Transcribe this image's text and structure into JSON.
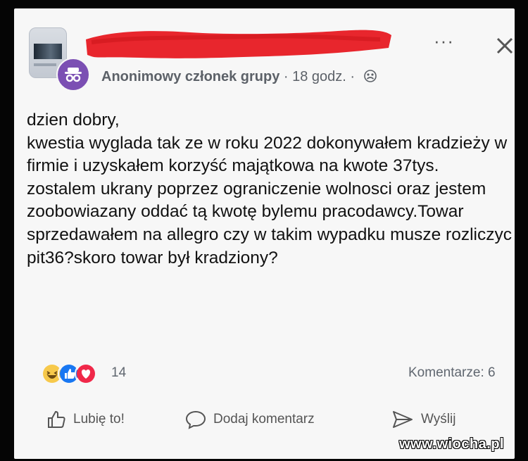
{
  "post": {
    "author": "Anonimowy członek grupy",
    "meta": " · 18 godz. · ",
    "privacy_icon": "group-members-icon",
    "body_lines": [
      "dzien dobry,",
      "kwestia wyglada tak ze w roku 2022 dokonywałem kradzieży w firmie i uzyskałem korzyść majątkowa na kwote 37tys.",
      "zostalem ukrany poprzez ograniczenie wolnosci oraz jestem zoobowiazany oddać tą kwotę bylemu pracodawcy.Towar sprzedawałem na allegro czy w takim wypadku musze rozliczyc pit36?skoro towar był kradziony?"
    ]
  },
  "header": {
    "more_label": "···",
    "redaction_color": "#e8262d"
  },
  "reactions": {
    "icons": [
      "haha-icon",
      "like-icon",
      "love-icon"
    ],
    "count": "14",
    "comments": "Komentarze: 6"
  },
  "actions": {
    "like": "Lubię to!",
    "comment": "Dodaj komentarz",
    "send": "Wyślij"
  },
  "watermark": "www.wiocha.pl",
  "colors": {
    "avatar": "#7b4fb3",
    "like_blue": "#1877f2",
    "love_red": "#f02849",
    "haha_yellow": "#f7c94b"
  }
}
